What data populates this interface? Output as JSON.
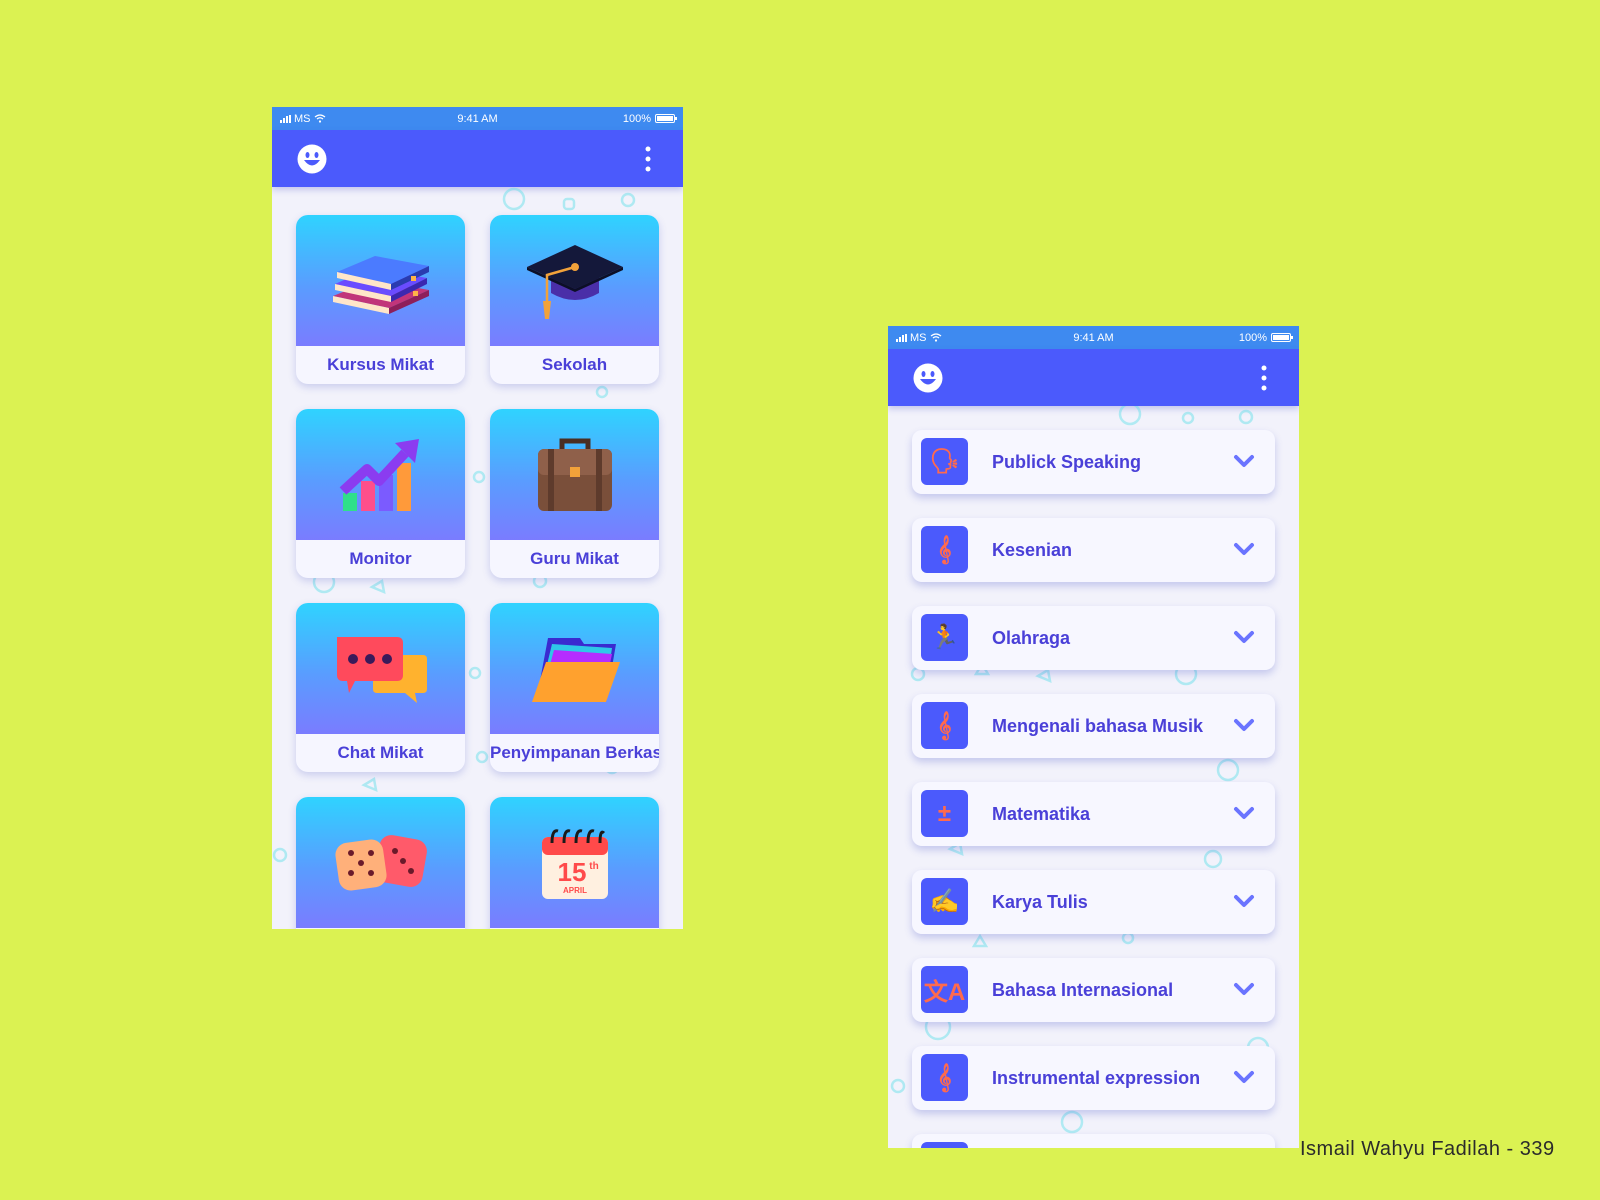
{
  "colors": {
    "background": "#dbf252",
    "status_bar": "#3e8af0",
    "app_bar": "#4b5afc",
    "accent_text": "#4a40d8",
    "icon_orange": "#ff6a4d"
  },
  "status_bar": {
    "carrier": "MS",
    "time": "9:41 AM",
    "battery": "100%"
  },
  "app_bar": {
    "logo_icon": "smiley-face-icon",
    "menu_icon": "more-vertical-icon"
  },
  "menu_grid": {
    "items": [
      {
        "label": "Kursus Mikat",
        "icon": "books-icon"
      },
      {
        "label": "Sekolah",
        "icon": "graduation-cap-icon"
      },
      {
        "label": "Monitor",
        "icon": "growth-chart-icon"
      },
      {
        "label": "Guru Mikat",
        "icon": "briefcase-icon"
      },
      {
        "label": "Chat Mikat",
        "icon": "chat-bubbles-icon"
      },
      {
        "label": "Penyimpanan Berkas",
        "icon": "folder-icon"
      },
      {
        "label": "",
        "icon": "dice-icon"
      },
      {
        "label": "",
        "icon": "calendar-icon"
      }
    ],
    "calendar_day": "15",
    "calendar_suffix": "th",
    "calendar_month": "APRIL"
  },
  "category_list": {
    "items": [
      {
        "label": "Publick Speaking",
        "icon": "speaking-head-icon",
        "glyph": "🗣"
      },
      {
        "label": "Kesenian",
        "icon": "treble-clef-icon",
        "glyph": "𝄞"
      },
      {
        "label": "Olahraga",
        "icon": "running-person-icon",
        "glyph": "🏃"
      },
      {
        "label": "Mengenali bahasa Musik",
        "icon": "treble-clef-icon",
        "glyph": "𝄞"
      },
      {
        "label": "Matematika",
        "icon": "math-operators-icon",
        "glyph": "±"
      },
      {
        "label": "Karya Tulis",
        "icon": "writing-hand-icon",
        "glyph": "✍"
      },
      {
        "label": "Bahasa Internasional",
        "icon": "translate-icon",
        "glyph": "文A"
      },
      {
        "label": "Instrumental expression",
        "icon": "treble-clef-icon",
        "glyph": "𝄞"
      }
    ]
  },
  "credit": "Ismail Wahyu Fadilah - 339"
}
